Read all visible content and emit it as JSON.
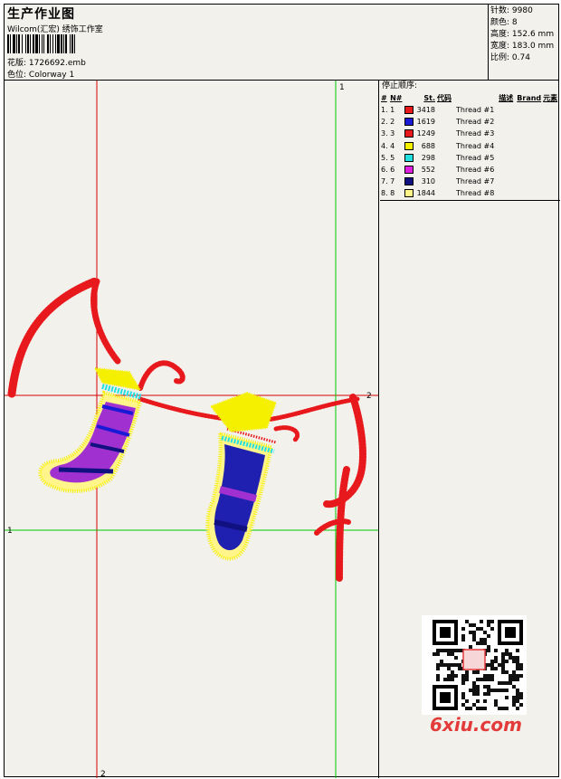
{
  "header": {
    "title": "生产作业图",
    "subtitle": "Wilcom(汇宏) 绣饰工作室",
    "design_file_label": "花版:",
    "design_file": "1726692.emb",
    "colorway_label": "色位:",
    "colorway": "Colorway 1"
  },
  "stats": {
    "stitches_label": "针数:",
    "stitches": "9980",
    "colors_label": "颜色:",
    "colors": "8",
    "height_label": "高度:",
    "height": "152.6 mm",
    "width_label": "宽度:",
    "width": "183.0 mm",
    "scale_label": "比例:",
    "scale": "0.74"
  },
  "design_markers": {
    "top_green": "1",
    "right_red": "2",
    "left_green": "1",
    "bottom_red": "2"
  },
  "stop_sequence": {
    "title": "停止顺序:",
    "headers": [
      "#",
      "N#",
      "St.",
      "代码",
      "描述",
      "Brand",
      "元素"
    ],
    "rows": [
      {
        "n": "1.",
        "needle": "1",
        "color": "#e8191c",
        "stitches": "3418",
        "desc": "Thread #1"
      },
      {
        "n": "2.",
        "needle": "2",
        "color": "#1a1ad6",
        "stitches": "1619",
        "desc": "Thread #2"
      },
      {
        "n": "3.",
        "needle": "3",
        "color": "#e8191c",
        "stitches": "1249",
        "desc": "Thread #3"
      },
      {
        "n": "4.",
        "needle": "4",
        "color": "#f5f000",
        "stitches": "688",
        "desc": "Thread #4"
      },
      {
        "n": "5.",
        "needle": "5",
        "color": "#22e0e0",
        "stitches": "298",
        "desc": "Thread #5"
      },
      {
        "n": "6.",
        "needle": "6",
        "color": "#e020e0",
        "stitches": "552",
        "desc": "Thread #6"
      },
      {
        "n": "7.",
        "needle": "7",
        "color": "#101080",
        "stitches": "310",
        "desc": "Thread #7"
      },
      {
        "n": "8.",
        "needle": "8",
        "color": "#fff58a",
        "stitches": "1844",
        "desc": "Thread #8"
      }
    ]
  },
  "watermark": {
    "text": "6xiu.com"
  }
}
